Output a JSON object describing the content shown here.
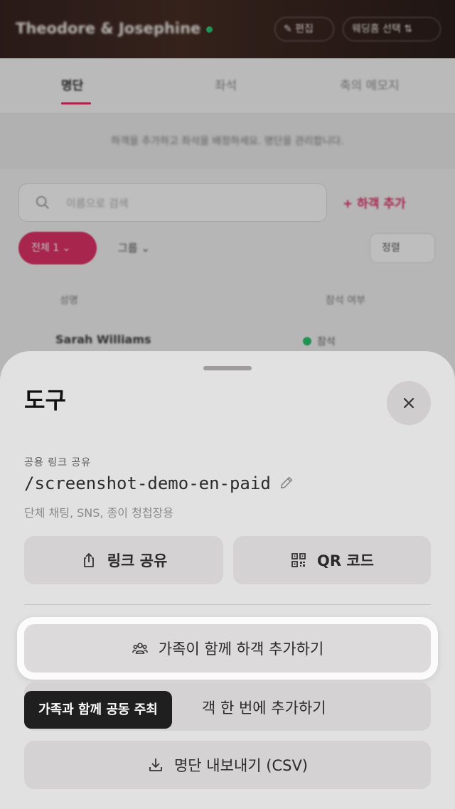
{
  "background": {
    "hero": {
      "title": "Theodore & Josephine",
      "edit_label": "✎ 편집",
      "select_label": "웨딩홈 선택 ⇅"
    },
    "tabs": [
      {
        "label": "명단"
      },
      {
        "label": "좌석"
      },
      {
        "label": "축의 메모지"
      }
    ],
    "notice": "하객을 추가하고 좌석을 배정하세요. 명단을 관리합니다.",
    "search_placeholder": "이름으로 검색",
    "add_guest_label": "+ 하객 추가",
    "filter_all": "전체 1 ⌄",
    "filter_group": "그룹 ⌄",
    "sort_label": "정렬",
    "table_headers": [
      "성명",
      "참석 여부"
    ],
    "rows": [
      {
        "name": "Sarah Williams",
        "status": "참석"
      }
    ]
  },
  "sheet": {
    "title": "도구",
    "public_link_label": "공용 링크 공유",
    "public_link_value": "/screenshot-demo-en-paid",
    "public_link_desc": "단체 채팅, SNS, 종이 청첩장용",
    "share_link_label": "링크 공유",
    "qr_code_label": "QR 코드",
    "add_family_label": "가족이 함께 하객 추가하기",
    "bulk_add_label": "객 한 번에 추가하기",
    "export_csv_label": "명단 내보내기 (CSV)",
    "tooltip_label": "가족과 함께 공동 주최"
  },
  "colors": {
    "accent": "#e0245e",
    "online": "#21c06b",
    "sheet_bg": "#e2e1e1",
    "button_bg": "#d4d2d2",
    "tooltip_bg": "#1f1f1f"
  }
}
